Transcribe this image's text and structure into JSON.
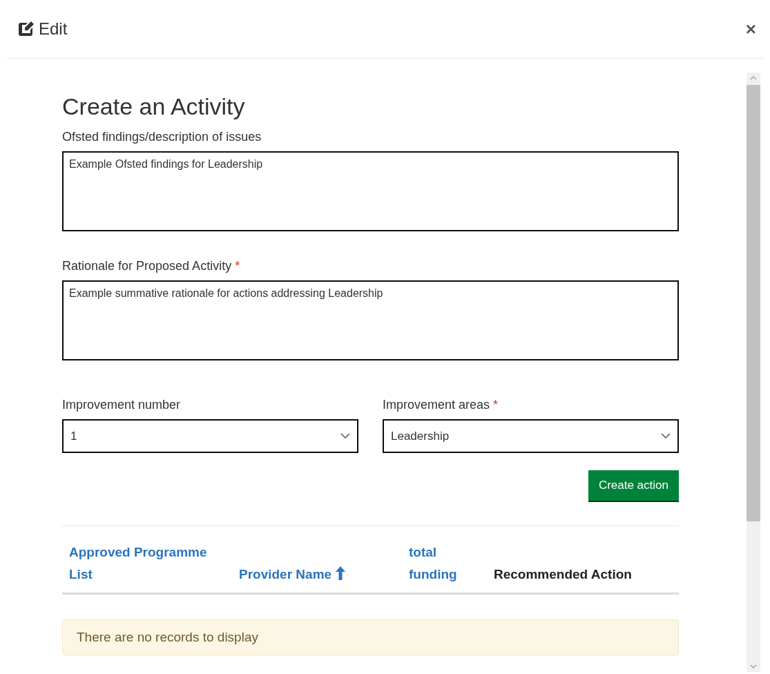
{
  "dialog": {
    "title": "Edit",
    "close": "×"
  },
  "form": {
    "heading": "Create an Activity",
    "findings": {
      "label": "Ofsted findings/description of issues",
      "required": false,
      "value": "Example Ofsted findings for Leadership"
    },
    "rationale": {
      "label": "Rationale for Proposed Activity",
      "required": true,
      "value": "Example summative rationale for actions addressing Leadership"
    },
    "improvement_number": {
      "label": "Improvement number",
      "required": false,
      "value": "1"
    },
    "improvement_areas": {
      "label": "Improvement areas",
      "required": true,
      "value": "Leadership"
    },
    "required_mark": "*",
    "button": "Create action"
  },
  "table": {
    "columns": [
      {
        "label": "Approved Programme List",
        "kind": "link",
        "sorted": false
      },
      {
        "label": "Provider Name",
        "kind": "link",
        "sorted": true
      },
      {
        "label": "total funding",
        "kind": "link",
        "sorted": false
      },
      {
        "label": "Recommended Action",
        "kind": "plain",
        "sorted": false
      }
    ],
    "empty_message": "There are no records to display"
  }
}
